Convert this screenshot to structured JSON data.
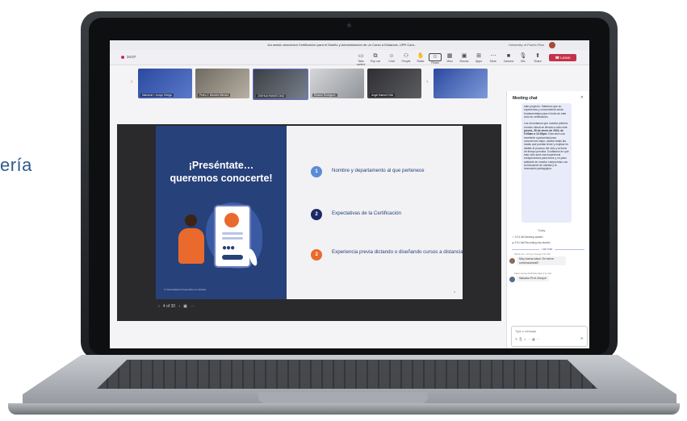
{
  "edge_text": "ería",
  "window": {
    "title": "1ra sesión sincrónica Certificación para el Diseño y Administración de un Curso a Distancia, UPR Caro...",
    "org": "University of Puerto Rico",
    "timer": "34:07"
  },
  "toolbar": {
    "buttons": [
      {
        "icon": "view-icon",
        "label": "Take control"
      },
      {
        "icon": "pop-out-icon",
        "label": "Pop out"
      },
      {
        "icon": "chat-icon",
        "label": "Chat"
      },
      {
        "icon": "people-icon",
        "label": "People",
        "count": "28"
      },
      {
        "icon": "raise-hand-icon",
        "label": "Raise"
      },
      {
        "icon": "react-icon",
        "label": "React"
      },
      {
        "icon": "view-grid-icon",
        "label": "View"
      },
      {
        "icon": "rooms-icon",
        "label": "Rooms"
      },
      {
        "icon": "apps-icon",
        "label": "Apps"
      },
      {
        "icon": "more-icon",
        "label": "More"
      },
      {
        "icon": "camera-icon",
        "label": "Camera"
      },
      {
        "icon": "mic-icon",
        "label": "Mic"
      },
      {
        "icon": "share-icon",
        "label": "Share"
      }
    ],
    "leave_label": "Leave"
  },
  "participants": [
    {
      "name": "Marianne I. Arroyo Ortega"
    },
    {
      "name": "Pedro J. Morales Méndez"
    },
    {
      "name": "JOSHUA RAMOS DIAZ"
    },
    {
      "name": "Ricardo Rodríguez"
    },
    {
      "name": "Angel Manuel Ortiz"
    },
    {
      "name": ""
    }
  ],
  "slide": {
    "heading_line1": "¡Preséntate…",
    "heading_line2": "queremos conocerte!",
    "copyright": "© Universidad de Puerto Rico en Carolina",
    "page_num": "4",
    "items": [
      {
        "n": "1",
        "text": "Nombre y departamento al que pertenece",
        "color": "#5b8bd6"
      },
      {
        "n": "2",
        "text": "Expectativas de la Certificación",
        "color": "#1c2b66"
      },
      {
        "n": "3",
        "text": "Experiencia previa dictando o diseñando cursos a distancia",
        "color": "#e96a2c"
      }
    ]
  },
  "stage_controls": {
    "prev": "‹",
    "page": "4 of 30",
    "next": "›"
  },
  "chat": {
    "title": "Meeting chat",
    "bubble_top": "este proyecto. Sabemos que su experiencia y conocimiento serán fundamentales para el éxito de este ciclo de certificación.",
    "bubble_pre": "Les recordamos que nuestra primera reunión virtual se llevará a cabo este ",
    "bubble_bold": "jueves, 25 de enero de 2024, de 9:30am a 12:30pm",
    "bubble_post": ". Esta será una excelente oportunidad para conocernos mejor, aclarar todas las dudas que puedan tener y explicar en detalle el proceso del ciclo y la línea de tiempo prevista. Confiamos en que este ciclo será una experiencia enriquecedora para todos y un paso adelante en nuestro compromiso con la educación de calidad y la innovación pedagógica.",
    "today": "Today",
    "sys1": "9:31 AM   Meeting started",
    "sys2": "9:31 AM   Recording has started",
    "last_read": "Last read",
    "msg1_meta": "Marianne I. Arroyo Ortega   9:37 AM",
    "msg1_text": "Muy buena idea!. En breve comenzamos!!!",
    "msg2_meta": "Pablo Daniel RODRIGUEZ   9:41 AM",
    "msg2_text": "Saludos Prof. Arroyo!",
    "input_placeholder": "Type a message"
  },
  "colors": {
    "slide_navy": "#27417a",
    "accent_orange": "#e96a2c",
    "leave_red": "#c4314b",
    "teams_purple": "#5b5fc7"
  }
}
